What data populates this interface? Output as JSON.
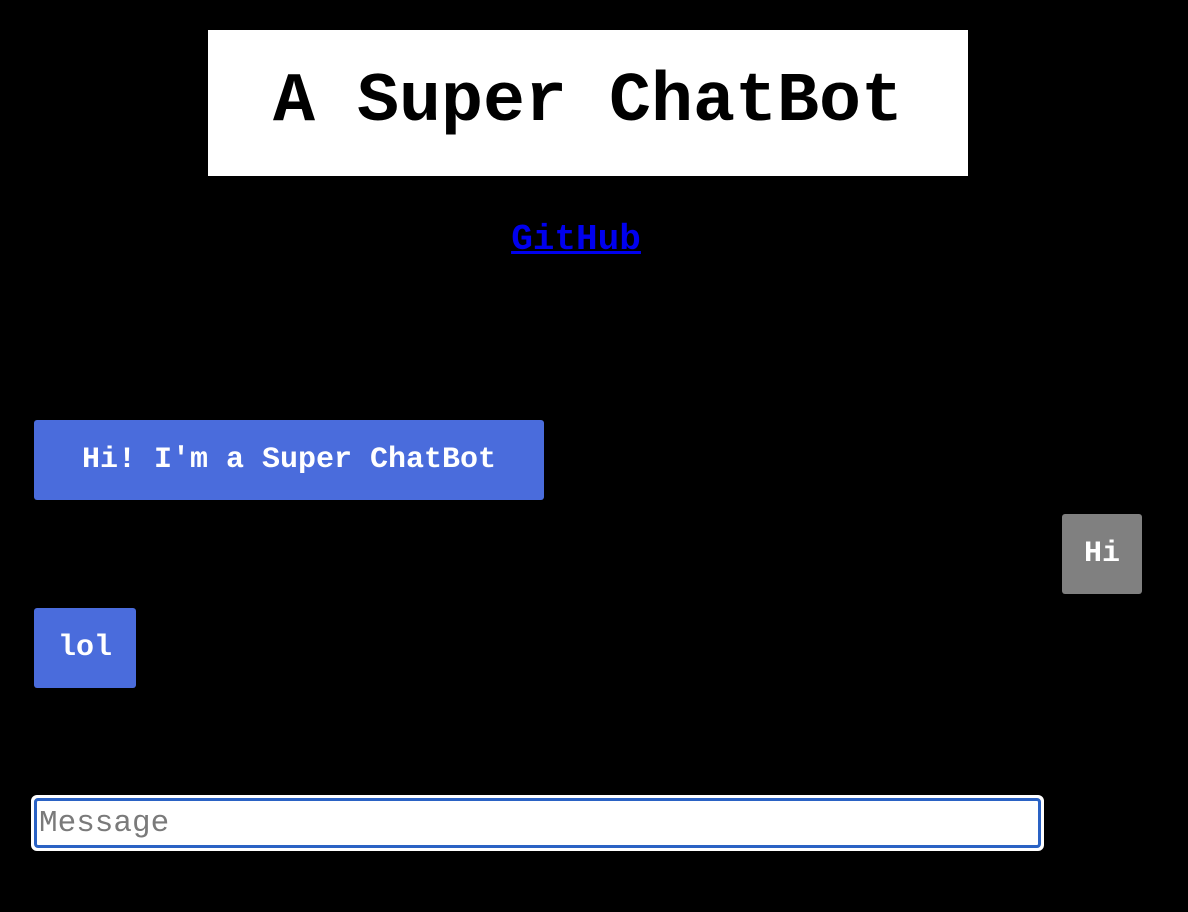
{
  "header": {
    "title": "A Super ChatBot",
    "link_label": "GitHub"
  },
  "chat": {
    "messages": [
      {
        "sender": "bot",
        "text": "Hi! I'm a Super ChatBot"
      },
      {
        "sender": "user",
        "text": "Hi"
      },
      {
        "sender": "bot",
        "text": "lol"
      }
    ]
  },
  "composer": {
    "placeholder": "Message",
    "value": ""
  },
  "colors": {
    "background": "#000000",
    "bot_bubble": "#4a6cdc",
    "user_bubble": "#808080",
    "link": "#0000ee",
    "input_focus": "#2a62c4"
  }
}
